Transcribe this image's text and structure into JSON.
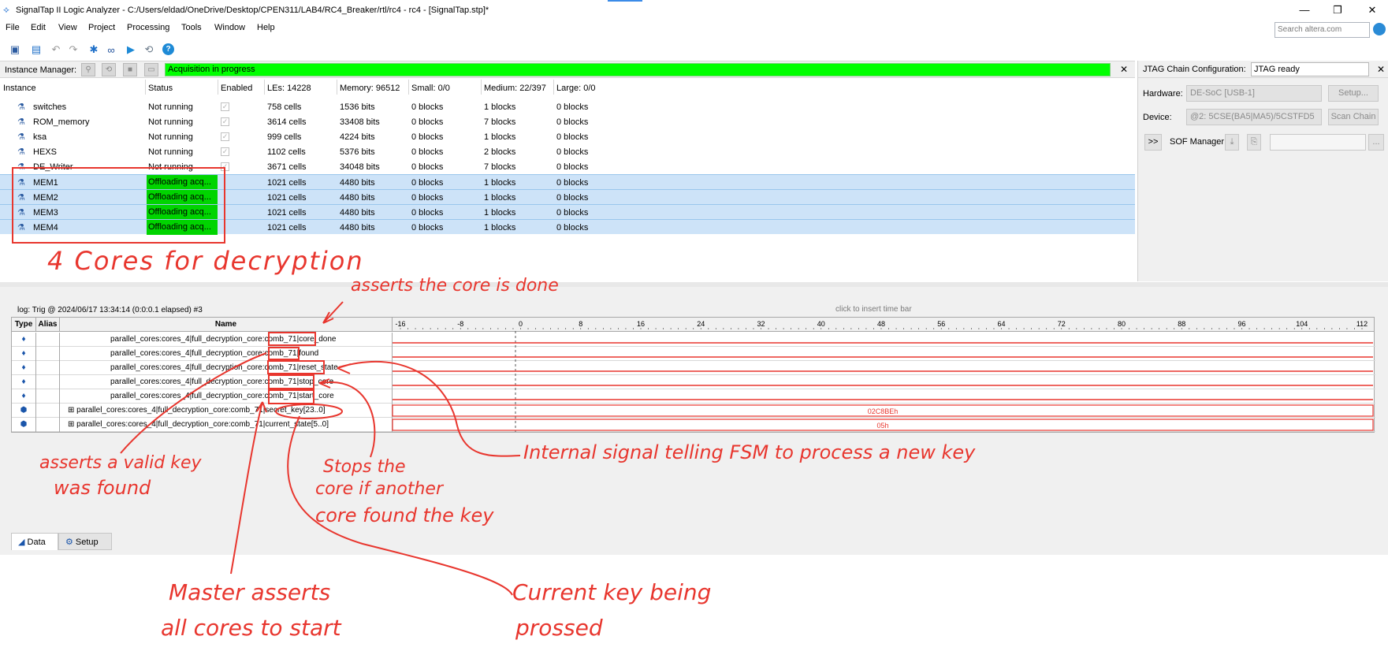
{
  "window": {
    "title": "SignalTap II Logic Analyzer - C:/Users/eldad/OneDrive/Desktop/CPEN311/LAB4/RC4_Breaker/rtl/rc4 - rc4 - [SignalTap.stp]*",
    "minimize": "—",
    "restore": "❐",
    "close": "✕"
  },
  "menu": [
    "File",
    "Edit",
    "View",
    "Project",
    "Processing",
    "Tools",
    "Window",
    "Help"
  ],
  "search": {
    "placeholder": "Search altera.com"
  },
  "instance_manager": {
    "label": "Instance Manager:",
    "status_text": "Acquisition in progress",
    "close": "✕",
    "columns": [
      "Instance",
      "Status",
      "Enabled",
      "LEs: 14228",
      "Memory: 96512",
      "Small: 0/0",
      "Medium: 22/397",
      "Large: 0/0"
    ],
    "rows": [
      {
        "instance": "switches",
        "status": "Not running",
        "les": "758 cells",
        "memory": "1536 bits",
        "small": "0 blocks",
        "medium": "1 blocks",
        "large": "0 blocks"
      },
      {
        "instance": "ROM_memory",
        "status": "Not running",
        "les": "3614 cells",
        "memory": "33408 bits",
        "small": "0 blocks",
        "medium": "7 blocks",
        "large": "0 blocks"
      },
      {
        "instance": "ksa",
        "status": "Not running",
        "les": "999 cells",
        "memory": "4224 bits",
        "small": "0 blocks",
        "medium": "1 blocks",
        "large": "0 blocks"
      },
      {
        "instance": "HEXS",
        "status": "Not running",
        "les": "1102 cells",
        "memory": "5376 bits",
        "small": "0 blocks",
        "medium": "2 blocks",
        "large": "0 blocks"
      },
      {
        "instance": "DE_Writer",
        "status": "Not running",
        "les": "3671 cells",
        "memory": "34048 bits",
        "small": "0 blocks",
        "medium": "7 blocks",
        "large": "0 blocks"
      },
      {
        "instance": "MEM1",
        "status": "Offloading acq...",
        "les": "1021 cells",
        "memory": "4480 bits",
        "small": "0 blocks",
        "medium": "1 blocks",
        "large": "0 blocks"
      },
      {
        "instance": "MEM2",
        "status": "Offloading acq...",
        "les": "1021 cells",
        "memory": "4480 bits",
        "small": "0 blocks",
        "medium": "1 blocks",
        "large": "0 blocks"
      },
      {
        "instance": "MEM3",
        "status": "Offloading acq...",
        "les": "1021 cells",
        "memory": "4480 bits",
        "small": "0 blocks",
        "medium": "1 blocks",
        "large": "0 blocks"
      },
      {
        "instance": "MEM4",
        "status": "Offloading acq...",
        "les": "1021 cells",
        "memory": "4480 bits",
        "small": "0 blocks",
        "medium": "1 blocks",
        "large": "0 blocks"
      }
    ]
  },
  "jtag": {
    "title": "JTAG Chain Configuration:",
    "status": "JTAG ready",
    "close": "✕",
    "hardware_label": "Hardware:",
    "hardware_value": "DE-SoC [USB-1]",
    "setup_button": "Setup...",
    "device_label": "Device:",
    "device_value": "@2: 5CSE(BA5|MA5)/5CSTFD5",
    "scan_chain_button": "Scan Chain",
    "expand_button": ">>",
    "sof_label": "SOF Manager:",
    "browse_button": "..."
  },
  "waveform": {
    "log": "log: Trig @ 2024/06/17 13:34:14 (0:0:0.1 elapsed) #3",
    "insert_time_bar": "click to insert time bar",
    "headers": {
      "type": "Type",
      "alias": "Alias",
      "name": "Name"
    },
    "ticks": [
      "-16",
      "-8",
      "0",
      "8",
      "16",
      "24",
      "32",
      "40",
      "48",
      "56",
      "64",
      "72",
      "80",
      "88",
      "96",
      "104",
      "112"
    ],
    "signals": [
      {
        "name": "parallel_cores:cores_4|full_decryption_core:comb_71|core_done",
        "value": ""
      },
      {
        "name": "parallel_cores:cores_4|full_decryption_core:comb_71|found",
        "value": ""
      },
      {
        "name": "parallel_cores:cores_4|full_decryption_core:comb_71|reset_state",
        "value": ""
      },
      {
        "name": "parallel_cores:cores_4|full_decryption_core:comb_71|stop_core",
        "value": ""
      },
      {
        "name": "parallel_cores:cores_4|full_decryption_core:comb_71|start_core",
        "value": ""
      },
      {
        "name": "parallel_cores:cores_4|full_decryption_core:comb_71|secret_key[23..0]",
        "value": "02C8BEh"
      },
      {
        "name": "parallel_cores:cores_4|full_decryption_core:comb_71|current_state[5..0]",
        "value": "05h"
      }
    ],
    "tabs": [
      "Data",
      "Setup"
    ]
  },
  "annotations": {
    "cores": "4 Cores for decryption",
    "core_done": "asserts the core is done",
    "valid_key_1": "asserts a valid key",
    "valid_key_2": "was found",
    "stops_1": "Stops the",
    "stops_2": "core if another",
    "stops_3": "core found the key",
    "internal": "Internal signal telling FSM to process a new key",
    "master_1": "Master asserts",
    "master_2": "all cores to start",
    "current_1": "Current key being",
    "current_2": "prossed"
  },
  "colors": {
    "status_green": "#00d400",
    "acq_green": "#00ff00",
    "annotation_red": "#e8362e",
    "selected_row": "#cde3f8"
  }
}
